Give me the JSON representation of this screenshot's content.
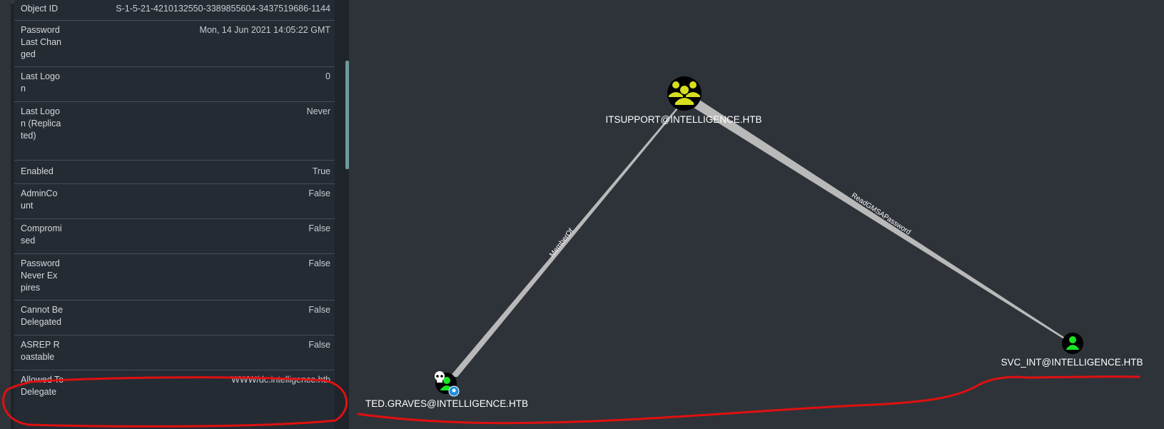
{
  "properties": [
    {
      "label": "Object ID",
      "value": "S-1-5-21-4210132550-3389855604-3437519686-1144"
    },
    {
      "label": "Password Last Changed",
      "value": "Mon, 14 Jun 2021 14:05:22 GMT"
    },
    {
      "label": "Last Logon",
      "value": "0"
    },
    {
      "label": "Last Logon (Replicated)",
      "value": "Never"
    },
    {
      "label": "Enabled",
      "value": "True"
    },
    {
      "label": "AdminCount",
      "value": "False"
    },
    {
      "label": "Compromised",
      "value": "False"
    },
    {
      "label": "Password Never Expires",
      "value": "False"
    },
    {
      "label": "Cannot Be Delegated",
      "value": "False"
    },
    {
      "label": "ASREP Roastable",
      "value": "False"
    },
    {
      "label": "Allowed To Delegate",
      "value": "WWW/dc.intelligence.htb"
    }
  ],
  "graph": {
    "nodes": {
      "itsupport": {
        "label": "ITSUPPORT@INTELLIGENCE.HTB",
        "type": "group",
        "icon": "group-icon",
        "color": "#d6df1f"
      },
      "ted": {
        "label": "TED.GRAVES@INTELLIGENCE.HTB",
        "type": "user",
        "icon": "user-icon",
        "color": "#17e625",
        "owned": true
      },
      "svc": {
        "label": "SVC_INT@INTELLIGENCE.HTB",
        "type": "user",
        "icon": "user-icon",
        "color": "#17e625"
      }
    },
    "edges": {
      "member_of": {
        "label": "MemberOf",
        "from": "ted",
        "to": "itsupport"
      },
      "read_gmsa": {
        "label": "ReadGMSAPassword",
        "from": "itsupport",
        "to": "svc"
      }
    }
  },
  "annotation_color": "#e01010"
}
